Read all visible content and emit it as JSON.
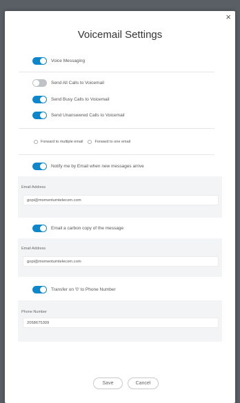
{
  "dialog": {
    "title": "Voicemail Settings",
    "close": "×"
  },
  "toggles": {
    "voice_messaging": {
      "label": "Voice Messaging",
      "on": true
    },
    "send_all": {
      "label": "Send All Calls to Voicemail",
      "on": false
    },
    "send_busy": {
      "label": "Send Busy Calls to Voicemail",
      "on": true
    },
    "send_unanswered": {
      "label": "Send Unanswered Calls to Voicemail",
      "on": true
    },
    "notify_email": {
      "label": "Notify me by Email when new messages arrive",
      "on": true
    },
    "carbon_copy": {
      "label": "Email a carbon copy of the message",
      "on": true
    },
    "transfer_zero": {
      "label": "Transfer on '0' to Phone Number",
      "on": true
    }
  },
  "forward": {
    "multiple_label": "Forward to multiple email",
    "one_label": "Forward to one email"
  },
  "notify_panel": {
    "label": "Email Address",
    "value": "gopi@momentumtelecom.com"
  },
  "carbon_panel": {
    "label": "Email Address",
    "value": "gopi@momentumtelecom.com"
  },
  "phone_panel": {
    "label": "Phone Number",
    "value": "2058675309"
  },
  "buttons": {
    "save": "Save",
    "cancel": "Cancel"
  },
  "colors": {
    "accent": "#0c87cb",
    "toggle_off": "#bfc3c7",
    "panel_bg": "#f3f4f5"
  }
}
